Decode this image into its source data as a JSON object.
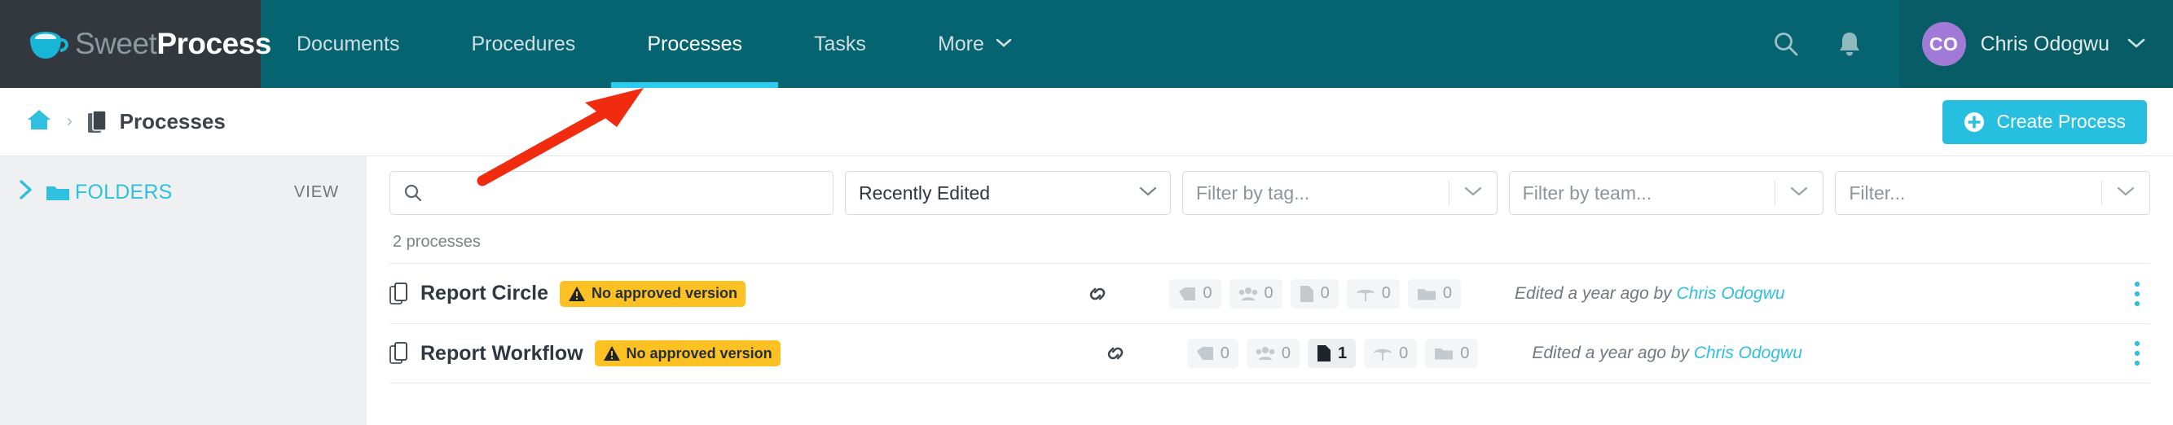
{
  "brand": {
    "logo_text_light": "Sweet",
    "logo_text_bold": "Process",
    "accent_cyan": "#29cdf0",
    "nav_teal": "#066470",
    "logo_bg": "#32383e",
    "badge_yellow": "#fdc123",
    "avatar_purple": "#a07ad6"
  },
  "topnav": {
    "tabs": [
      {
        "label": "Documents",
        "active": false
      },
      {
        "label": "Procedures",
        "active": false
      },
      {
        "label": "Processes",
        "active": true
      },
      {
        "label": "Tasks",
        "active": false
      },
      {
        "label": "More",
        "active": false,
        "caret": "⌄"
      }
    ],
    "search_icon": "search-icon",
    "bell_icon": "bell-icon",
    "user": {
      "initials": "CO",
      "name": "Chris Odogwu",
      "caret": "⌄"
    }
  },
  "breadcrumb": {
    "home_icon": "home-icon",
    "separator": "›",
    "doc_icon": "processes-icon",
    "label": "Processes",
    "create_button": "Create Process"
  },
  "sidebar": {
    "caret": "❯",
    "folders_label": "FOLDERS",
    "view_label": "VIEW"
  },
  "filters": {
    "search_placeholder": "",
    "search_value": "",
    "sort_selected": "Recently Edited",
    "tag_placeholder": "Filter by tag...",
    "team_placeholder": "Filter by team...",
    "other_placeholder": "Filter...",
    "caret": "⌄"
  },
  "list": {
    "count_text": "2 processes",
    "rows": [
      {
        "title": "Report Circle",
        "badge": "No approved version",
        "chips": [
          {
            "icon": "tag-icon",
            "value": "0",
            "highlight": false
          },
          {
            "icon": "team-icon",
            "value": "0",
            "highlight": false
          },
          {
            "icon": "document-icon",
            "value": "0",
            "highlight": false
          },
          {
            "icon": "umbrella-icon",
            "value": "0",
            "highlight": false
          },
          {
            "icon": "folder-icon",
            "value": "0",
            "highlight": false
          }
        ],
        "edited_prefix": "Edited a year ago by",
        "edited_author": "Chris Odogwu"
      },
      {
        "title": "Report Workflow",
        "badge": "No approved version",
        "chips": [
          {
            "icon": "tag-icon",
            "value": "0",
            "highlight": false
          },
          {
            "icon": "team-icon",
            "value": "0",
            "highlight": false
          },
          {
            "icon": "document-icon",
            "value": "1",
            "highlight": true
          },
          {
            "icon": "umbrella-icon",
            "value": "0",
            "highlight": false
          },
          {
            "icon": "folder-icon",
            "value": "0",
            "highlight": false
          }
        ],
        "edited_prefix": "Edited a year ago by",
        "edited_author": "Chris Odogwu"
      }
    ]
  },
  "annotation": {
    "type": "arrow",
    "color": "#f02b10",
    "points_to": "Processes tab"
  }
}
